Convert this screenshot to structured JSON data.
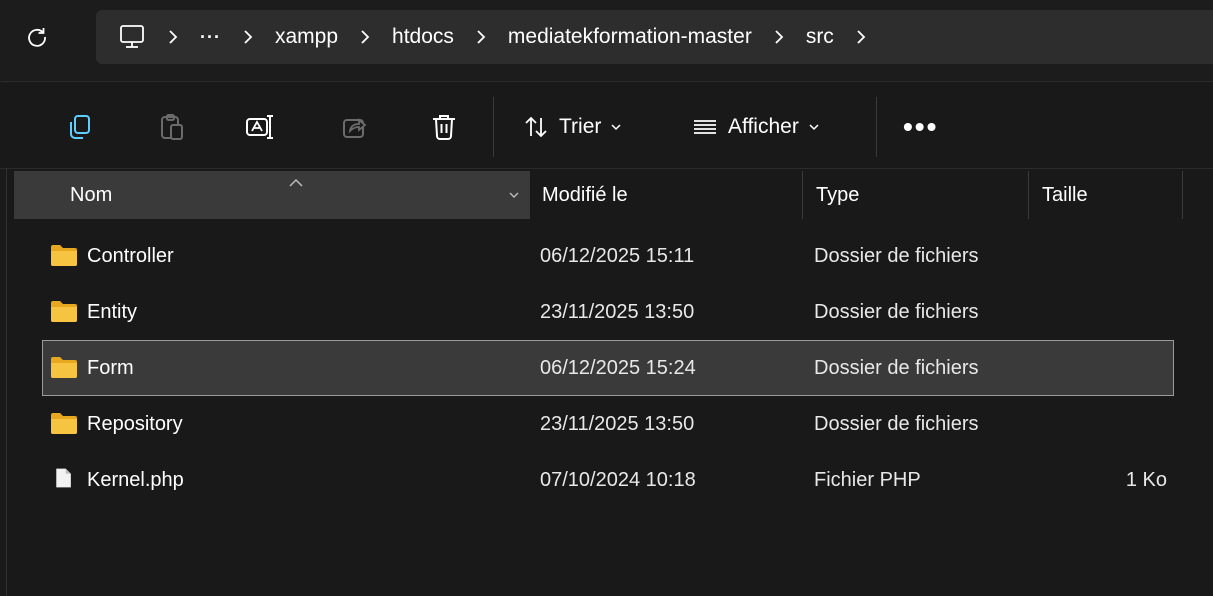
{
  "breadcrumb": {
    "ellipsis": "···",
    "items": [
      "xampp",
      "htdocs",
      "mediatekformation-master",
      "src"
    ]
  },
  "toolbar": {
    "icons": [
      "copy-icon",
      "paste-icon",
      "rename-icon",
      "share-icon",
      "delete-icon"
    ],
    "sort_label": "Trier",
    "view_label": "Afficher",
    "more_label": "•••"
  },
  "columns": {
    "name": "Nom",
    "modified": "Modifié le",
    "type": "Type",
    "size": "Taille"
  },
  "files": [
    {
      "name": "Controller",
      "modified": "06/12/2025 15:11",
      "type": "Dossier de fichiers",
      "size": "",
      "icon": "folder-icon",
      "selected": false
    },
    {
      "name": "Entity",
      "modified": "23/11/2025 13:50",
      "type": "Dossier de fichiers",
      "size": "",
      "icon": "folder-icon",
      "selected": false
    },
    {
      "name": "Form",
      "modified": "06/12/2025 15:24",
      "type": "Dossier de fichiers",
      "size": "",
      "icon": "folder-icon",
      "selected": true
    },
    {
      "name": "Repository",
      "modified": "23/11/2025 13:50",
      "type": "Dossier de fichiers",
      "size": "",
      "icon": "folder-icon",
      "selected": false
    },
    {
      "name": "Kernel.php",
      "modified": "07/10/2024 10:18",
      "type": "Fichier PHP",
      "size": "1 Ko",
      "icon": "file-icon",
      "selected": false
    }
  ],
  "colors": {
    "folder": "#f6c440",
    "selection_bg": "#3a3a3a",
    "background": "#191919"
  }
}
